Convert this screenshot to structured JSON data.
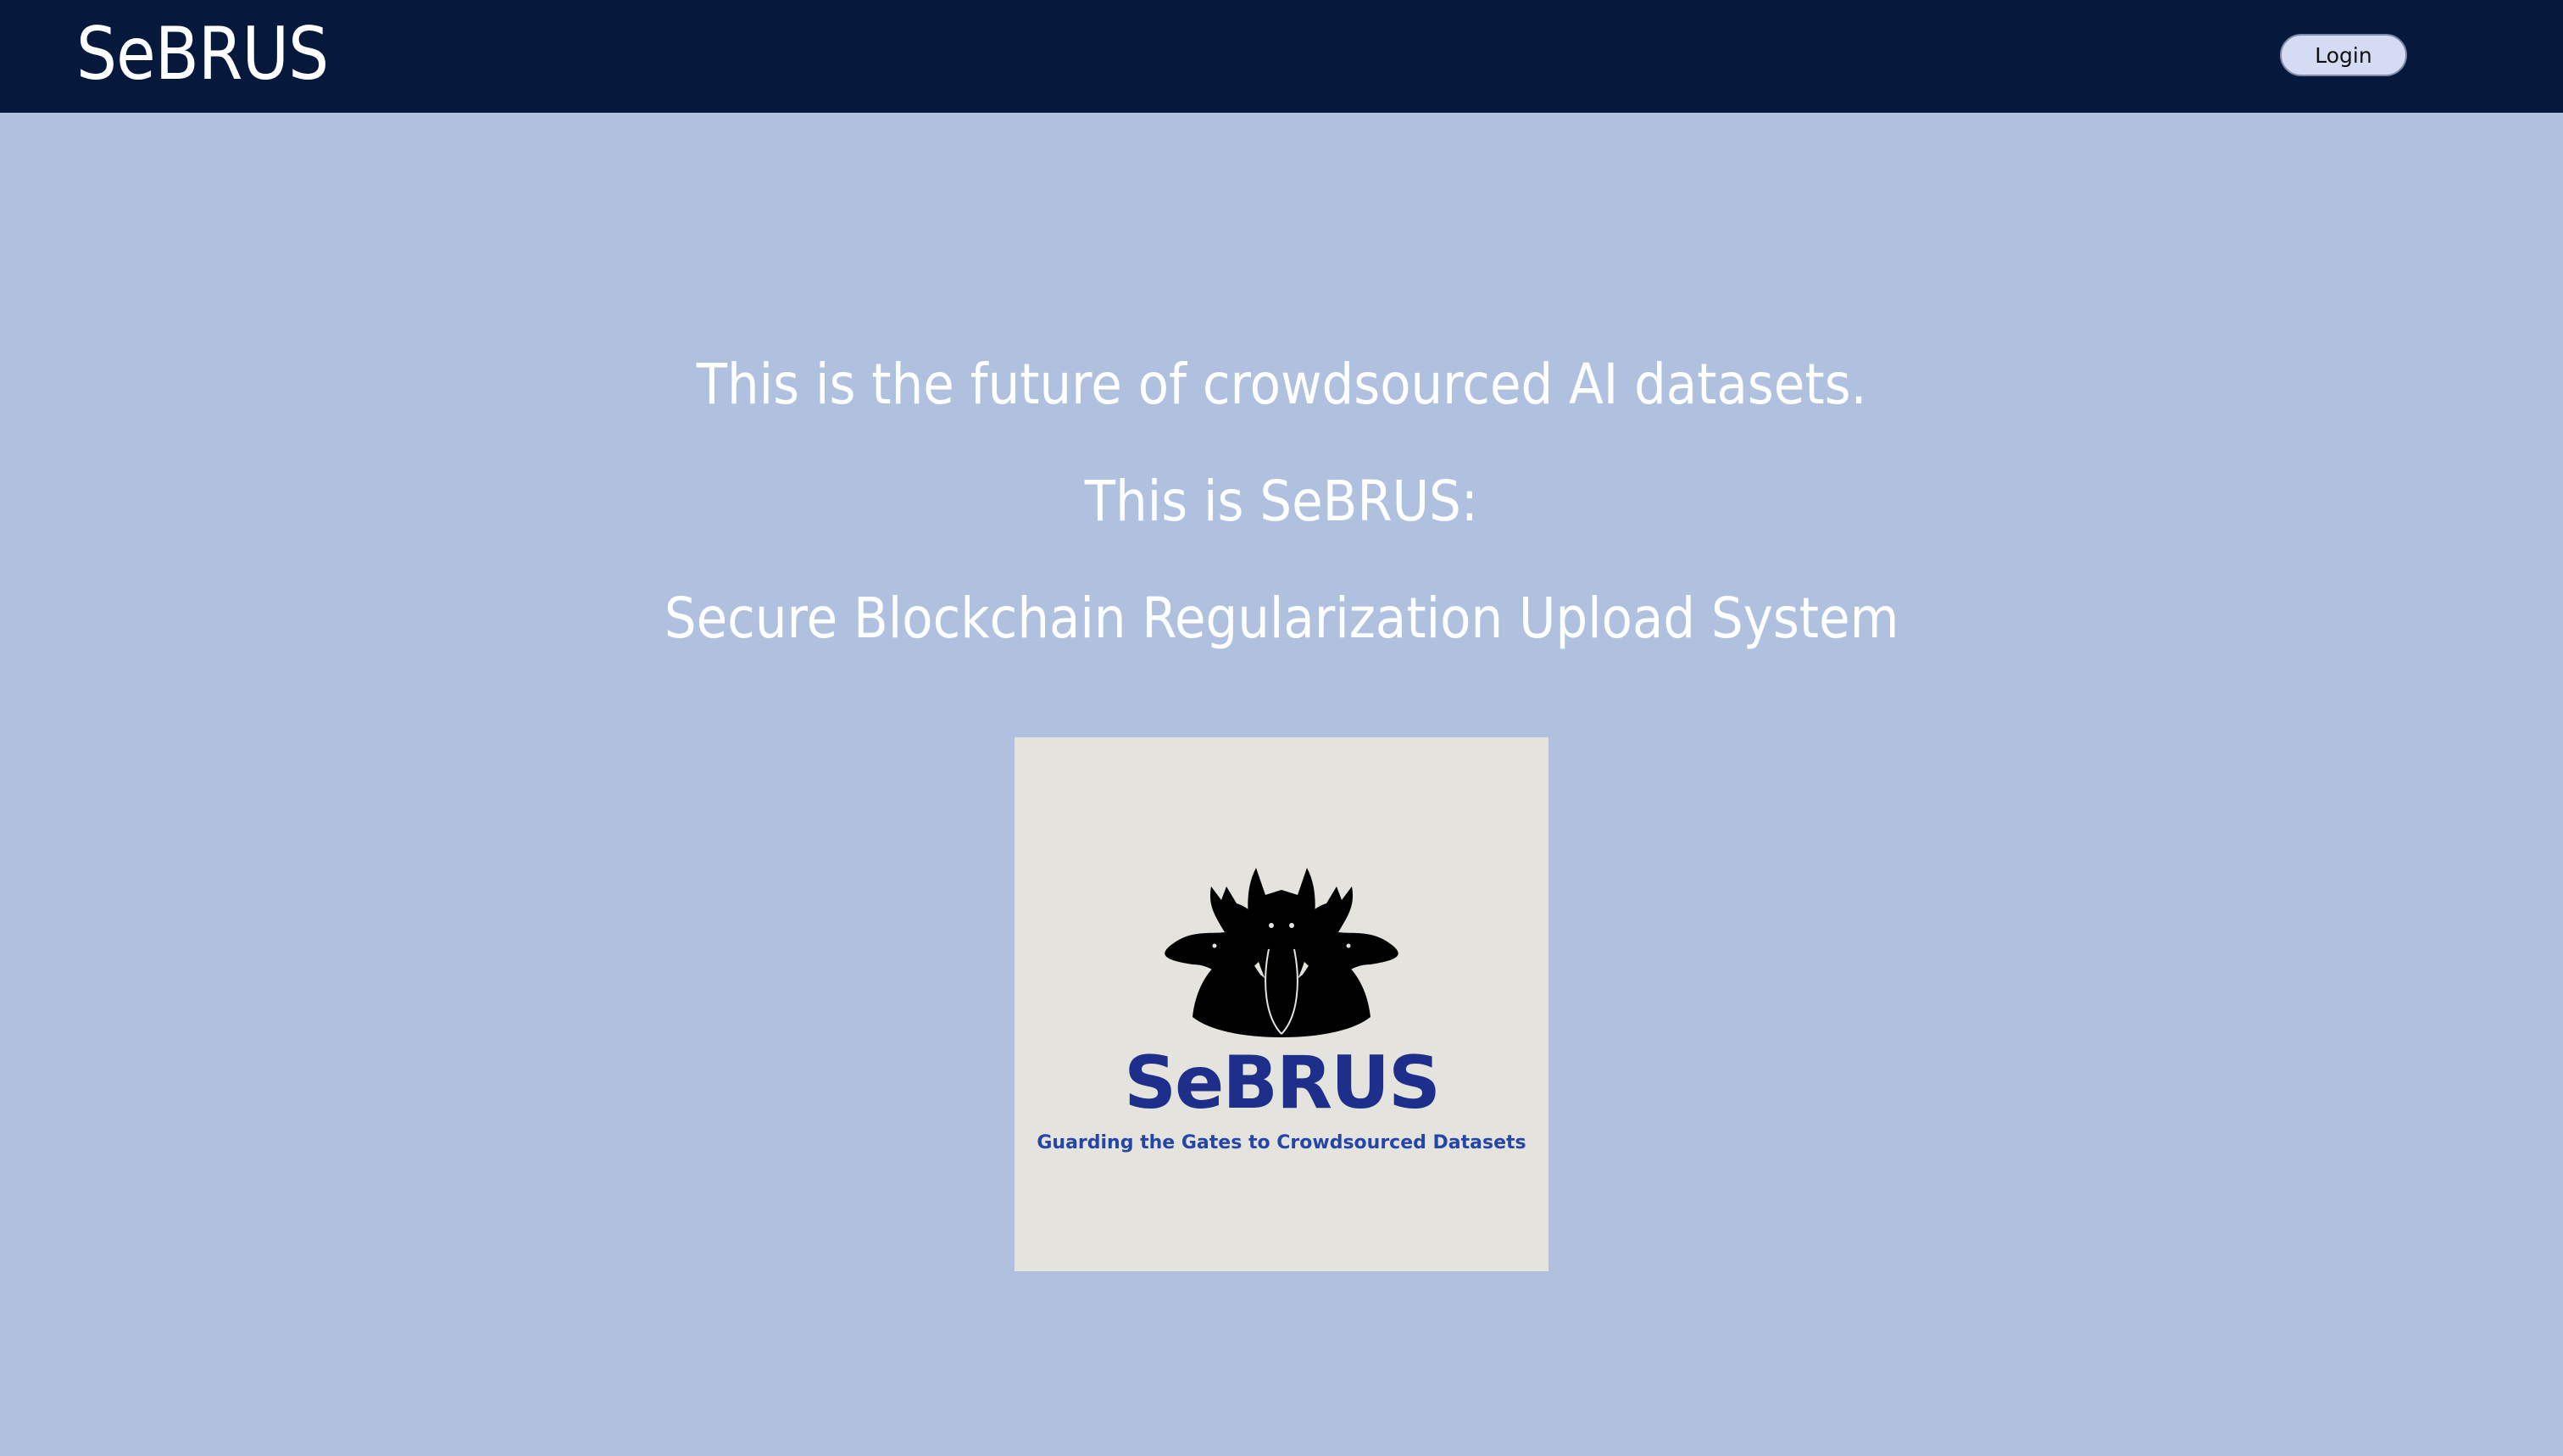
{
  "header": {
    "brand": "SeBRUS",
    "login_label": "Login"
  },
  "hero": {
    "line1": "This is the future of crowdsourced AI datasets.",
    "line2": "This is SeBRUS:",
    "line3": "Secure Blockchain Regularization Upload System"
  },
  "logo": {
    "wordmark": "SeBRUS",
    "tagline": "Guarding the Gates to Crowdsourced Datasets",
    "icon": "three-headed-dog-icon"
  },
  "colors": {
    "navbar": "#06193c",
    "background": "#b0c1df",
    "button": "#d4dbf3",
    "logo_card": "#e5e3de",
    "wordmark": "#1d2f8b"
  }
}
